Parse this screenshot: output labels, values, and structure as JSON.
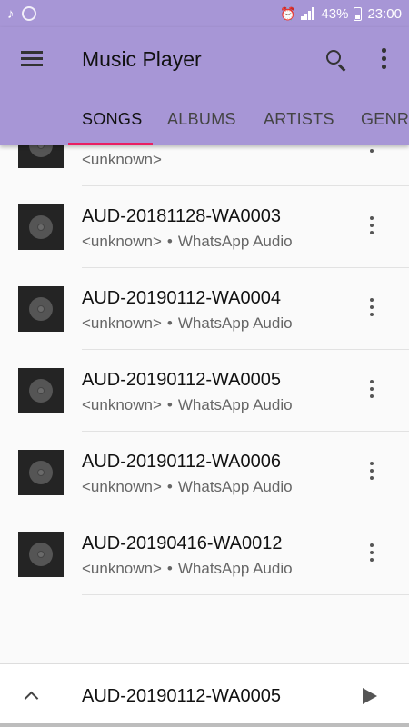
{
  "status_bar": {
    "battery": "43%",
    "time": "23:00"
  },
  "app_bar": {
    "title": "Music Player",
    "tabs": [
      {
        "label": "SONGS",
        "active": true
      },
      {
        "label": "ALBUMS",
        "active": false
      },
      {
        "label": "ARTISTS",
        "active": false
      },
      {
        "label": "GENRES",
        "active": false
      }
    ],
    "accent_color": "#e91e63",
    "primary_color": "#a796d6"
  },
  "songs": [
    {
      "title": "",
      "artist": "<unknown>",
      "album": ""
    },
    {
      "title": "AUD-20181128-WA0003",
      "artist": "<unknown>",
      "album": "WhatsApp Audio"
    },
    {
      "title": "AUD-20190112-WA0004",
      "artist": "<unknown>",
      "album": "WhatsApp Audio"
    },
    {
      "title": "AUD-20190112-WA0005",
      "artist": "<unknown>",
      "album": "WhatsApp Audio"
    },
    {
      "title": "AUD-20190112-WA0006",
      "artist": "<unknown>",
      "album": "WhatsApp Audio"
    },
    {
      "title": "AUD-20190416-WA0012",
      "artist": "<unknown>",
      "album": "WhatsApp Audio"
    }
  ],
  "separator": "•",
  "now_playing": {
    "title": "AUD-20190112-WA0005"
  }
}
